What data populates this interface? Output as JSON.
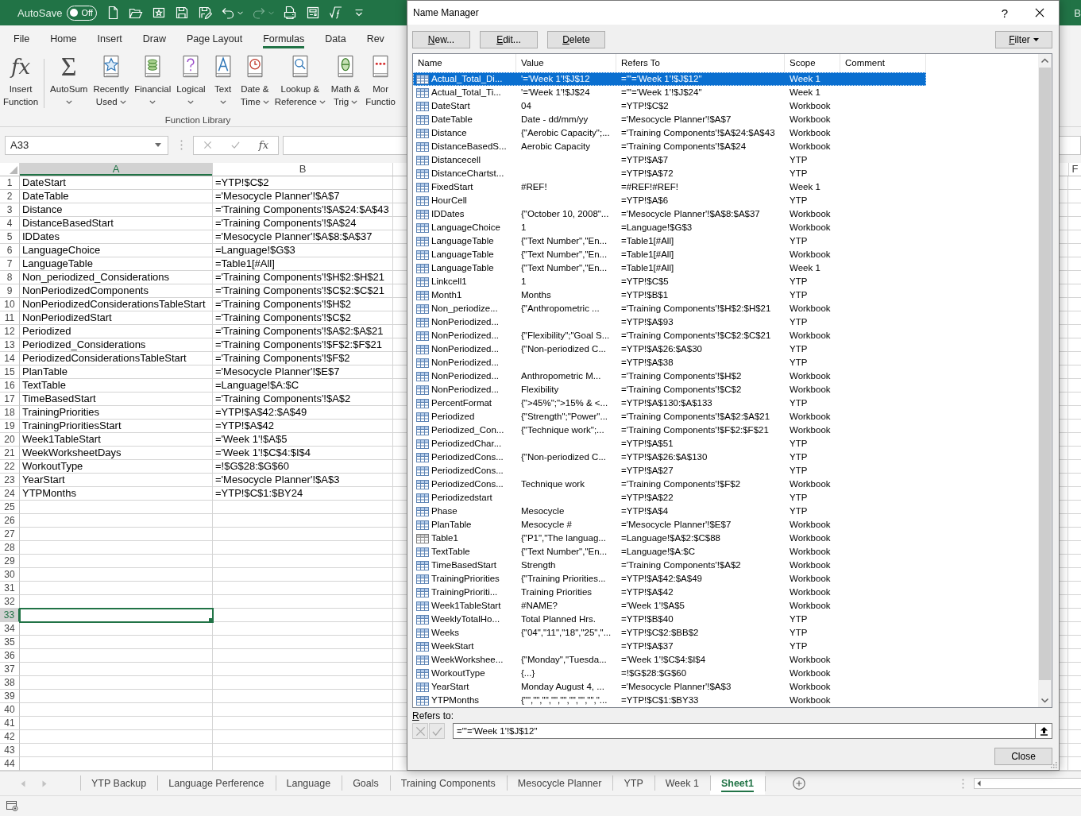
{
  "title_bar": {
    "autosave_label": "AutoSave",
    "autosave": {
      "on": false,
      "label": "Off"
    },
    "quick_access": [
      {
        "kind": "new",
        "disabled": false,
        "dropdown": false
      },
      {
        "kind": "open",
        "disabled": false,
        "dropdown": false
      },
      {
        "kind": "favorites",
        "disabled": false,
        "dropdown": false
      },
      {
        "kind": "save",
        "disabled": false,
        "dropdown": false
      },
      {
        "kind": "save_as",
        "disabled": false,
        "dropdown": false
      },
      {
        "kind": "undo",
        "disabled": false,
        "dropdown": true
      },
      {
        "kind": "redo",
        "disabled": true,
        "dropdown": true
      },
      {
        "kind": "print_preview",
        "disabled": false,
        "dropdown": false
      },
      {
        "kind": "form",
        "disabled": false,
        "dropdown": false
      },
      {
        "kind": "clear_formula",
        "disabled": false,
        "dropdown": false
      },
      {
        "kind": "customize",
        "disabled": false,
        "dropdown": false
      }
    ],
    "title_fragment": "B"
  },
  "ribbon": {
    "tabs": [
      {
        "label": "File",
        "selected": false
      },
      {
        "label": "Home",
        "selected": false
      },
      {
        "label": "Insert",
        "selected": false
      },
      {
        "label": "Draw",
        "selected": false
      },
      {
        "label": "Page Layout",
        "selected": false
      },
      {
        "label": "Formulas",
        "selected": true
      },
      {
        "label": "Data",
        "selected": false
      },
      {
        "label": "Rev",
        "selected": false
      }
    ],
    "group": {
      "label": "Function Library",
      "commands": [
        {
          "kind": "fx",
          "glyph": "fx",
          "lines": [
            "Insert",
            "Function"
          ],
          "dropdown": false,
          "separator_after": true
        },
        {
          "kind": "sum",
          "glyph": "Σ",
          "lines": [
            "AutoSum"
          ],
          "dropdown": true,
          "separator_after": false
        },
        {
          "kind": "recent",
          "lines": [
            "Recently",
            "Used"
          ],
          "dropdown": true,
          "separator_after": false
        },
        {
          "kind": "financial",
          "lines": [
            "Financial"
          ],
          "dropdown": true,
          "separator_after": false
        },
        {
          "kind": "logical",
          "lines": [
            "Logical"
          ],
          "dropdown": true,
          "separator_after": false
        },
        {
          "kind": "text",
          "lines": [
            "Text"
          ],
          "dropdown": true,
          "separator_after": false
        },
        {
          "kind": "datetime",
          "lines": [
            "Date &",
            "Time"
          ],
          "dropdown": true,
          "separator_after": false
        },
        {
          "kind": "lookup",
          "lines": [
            "Lookup &",
            "Reference"
          ],
          "dropdown": true,
          "separator_after": false
        },
        {
          "kind": "math",
          "lines": [
            "Math &",
            "Trig"
          ],
          "dropdown": true,
          "separator_after": false
        },
        {
          "kind": "more",
          "lines": [
            "Mor",
            "Functio"
          ],
          "dropdown": false,
          "separator_after": false
        }
      ]
    }
  },
  "formula_bar": {
    "name_box": "A33",
    "function_glyph": "fx",
    "editing": false
  },
  "sheet": {
    "columns": [
      {
        "label": "A",
        "selected": true
      },
      {
        "label": "B",
        "selected": false
      }
    ],
    "edge_column": {
      "label": "F",
      "selected": false
    },
    "rows": [
      {
        "number": "1",
        "cells": [
          "DateStart",
          "=YTP!$C$2"
        ],
        "selected": false
      },
      {
        "number": "2",
        "cells": [
          "DateTable",
          "='Mesocycle Planner'!$A$7"
        ],
        "selected": false
      },
      {
        "number": "3",
        "cells": [
          "Distance",
          "='Training Components'!$A$24:$A$43"
        ],
        "selected": false
      },
      {
        "number": "4",
        "cells": [
          "DistanceBasedStart",
          "='Training Components'!$A$24"
        ],
        "selected": false
      },
      {
        "number": "5",
        "cells": [
          "IDDates",
          "='Mesocycle Planner'!$A$8:$A$37"
        ],
        "selected": false
      },
      {
        "number": "6",
        "cells": [
          "LanguageChoice",
          "=Language!$G$3"
        ],
        "selected": false
      },
      {
        "number": "7",
        "cells": [
          "LanguageTable",
          "=Table1[#All]"
        ],
        "selected": false
      },
      {
        "number": "8",
        "cells": [
          "Non_periodized_Considerations",
          "='Training Components'!$H$2:$H$21"
        ],
        "selected": false
      },
      {
        "number": "9",
        "cells": [
          "NonPeriodizedComponents",
          "='Training Components'!$C$2:$C$21"
        ],
        "selected": false
      },
      {
        "number": "10",
        "cells": [
          "NonPeriodizedConsiderationsTableStart",
          "='Training Components'!$H$2"
        ],
        "selected": false
      },
      {
        "number": "11",
        "cells": [
          "NonPeriodizedStart",
          "='Training Components'!$C$2"
        ],
        "selected": false
      },
      {
        "number": "12",
        "cells": [
          "Periodized",
          "='Training Components'!$A$2:$A$21"
        ],
        "selected": false
      },
      {
        "number": "13",
        "cells": [
          "Periodized_Considerations",
          "='Training Components'!$F$2:$F$21"
        ],
        "selected": false
      },
      {
        "number": "14",
        "cells": [
          "PeriodizedConsiderationsTableStart",
          "='Training Components'!$F$2"
        ],
        "selected": false
      },
      {
        "number": "15",
        "cells": [
          "PlanTable",
          "='Mesocycle Planner'!$E$7"
        ],
        "selected": false
      },
      {
        "number": "16",
        "cells": [
          "TextTable",
          "=Language!$A:$C"
        ],
        "selected": false
      },
      {
        "number": "17",
        "cells": [
          "TimeBasedStart",
          "='Training Components'!$A$2"
        ],
        "selected": false
      },
      {
        "number": "18",
        "cells": [
          "TrainingPriorities",
          "=YTP!$A$42:$A$49"
        ],
        "selected": false
      },
      {
        "number": "19",
        "cells": [
          "TrainingPrioritiesStart",
          "=YTP!$A$42"
        ],
        "selected": false
      },
      {
        "number": "20",
        "cells": [
          "Week1TableStart",
          "='Week 1'!$A$5"
        ],
        "selected": false
      },
      {
        "number": "21",
        "cells": [
          "WeekWorksheetDays",
          "='Week 1'!$C$4:$I$4"
        ],
        "selected": false
      },
      {
        "number": "22",
        "cells": [
          "WorkoutType",
          "=!$G$28:$G$60"
        ],
        "selected": false
      },
      {
        "number": "23",
        "cells": [
          "YearStart",
          "='Mesocycle Planner'!$A$3"
        ],
        "selected": false
      },
      {
        "number": "24",
        "cells": [
          "YTPMonths",
          "=YTP!$C$1:$BY24"
        ],
        "selected": false
      },
      {
        "number": "25",
        "selected": false
      },
      {
        "number": "26",
        "selected": false
      },
      {
        "number": "27",
        "selected": false
      },
      {
        "number": "28",
        "selected": false
      },
      {
        "number": "29",
        "selected": false
      },
      {
        "number": "30",
        "selected": false
      },
      {
        "number": "31",
        "selected": false
      },
      {
        "number": "32",
        "selected": false
      },
      {
        "number": "33",
        "selected": true
      },
      {
        "number": "34",
        "selected": false
      },
      {
        "number": "35",
        "selected": false
      },
      {
        "number": "36",
        "selected": false
      },
      {
        "number": "37",
        "selected": false
      },
      {
        "number": "38",
        "selected": false
      },
      {
        "number": "39",
        "selected": false
      },
      {
        "number": "40",
        "selected": false
      },
      {
        "number": "41",
        "selected": false
      },
      {
        "number": "42",
        "selected": false
      },
      {
        "number": "43",
        "selected": false
      },
      {
        "number": "44",
        "selected": false
      }
    ]
  },
  "sheet_tabs": {
    "nav_disabled": true,
    "tabs": [
      {
        "label": "YTP Backup",
        "selected": false
      },
      {
        "label": "Language Perference",
        "selected": false
      },
      {
        "label": "Language",
        "selected": false
      },
      {
        "label": "Goals",
        "selected": false
      },
      {
        "label": "Training Components",
        "selected": false
      },
      {
        "label": "Mesocycle Planner",
        "selected": false
      },
      {
        "label": "YTP",
        "selected": false
      },
      {
        "label": "Week 1",
        "selected": false
      },
      {
        "label": "Sheet1",
        "selected": true
      }
    ]
  },
  "name_manager": {
    "title": "Name Manager",
    "help": "?",
    "buttons": [
      {
        "label": "New...",
        "mnemonic": true
      },
      {
        "label": "Edit...",
        "mnemonic": true
      },
      {
        "label": "Delete",
        "mnemonic": true
      }
    ],
    "filter": {
      "label": "Filter",
      "mnemonic": true
    },
    "columns": [
      "Name",
      "Value",
      "Refers To",
      "Scope",
      "Comment"
    ],
    "rows": [
      {
        "kind": "name",
        "name": "Actual_Total_Di...",
        "value": "'='Week 1'!$J$12",
        "refers_to": "=\"'='Week 1'!$J$12\"",
        "scope": "Week 1",
        "selected": true
      },
      {
        "kind": "name",
        "name": "Actual_Total_Ti...",
        "value": "'='Week 1'!$J$24",
        "refers_to": "=\"'='Week 1'!$J$24\"",
        "scope": "Week 1",
        "selected": false
      },
      {
        "kind": "name",
        "name": "DateStart",
        "value": "04",
        "refers_to": "=YTP!$C$2",
        "scope": "Workbook",
        "selected": false
      },
      {
        "kind": "name",
        "name": "DateTable",
        "value": "Date - dd/mm/yy",
        "refers_to": "='Mesocycle Planner'!$A$7",
        "scope": "Workbook",
        "selected": false
      },
      {
        "kind": "name",
        "name": "Distance",
        "value": "{\"Aerobic Capacity\";...",
        "refers_to": "='Training Components'!$A$24:$A$43",
        "scope": "Workbook",
        "selected": false
      },
      {
        "kind": "name",
        "name": "DistanceBasedS...",
        "value": "Aerobic Capacity",
        "refers_to": "='Training Components'!$A$24",
        "scope": "Workbook",
        "selected": false
      },
      {
        "kind": "name",
        "name": "Distancecell",
        "refers_to": "=YTP!$A$7",
        "scope": "YTP",
        "selected": false
      },
      {
        "kind": "name",
        "name": "DistanceChartst...",
        "refers_to": "=YTP!$A$72",
        "scope": "YTP",
        "selected": false
      },
      {
        "kind": "name",
        "name": "FixedStart",
        "value": "#REF!",
        "refers_to": "=#REF!#REF!",
        "scope": "Week 1",
        "selected": false
      },
      {
        "kind": "name",
        "name": "HourCell",
        "refers_to": "=YTP!$A$6",
        "scope": "YTP",
        "selected": false
      },
      {
        "kind": "name",
        "name": "IDDates",
        "value": "{\"October 10, 2008\"...",
        "refers_to": "='Mesocycle Planner'!$A$8:$A$37",
        "scope": "Workbook",
        "selected": false
      },
      {
        "kind": "name",
        "name": "LanguageChoice",
        "value": "1",
        "refers_to": "=Language!$G$3",
        "scope": "Workbook",
        "selected": false
      },
      {
        "kind": "name",
        "name": "LanguageTable",
        "value": "{\"Text Number\",\"En...",
        "refers_to": "=Table1[#All]",
        "scope": "YTP",
        "selected": false
      },
      {
        "kind": "name",
        "name": "LanguageTable",
        "value": "{\"Text Number\",\"En...",
        "refers_to": "=Table1[#All]",
        "scope": "Workbook",
        "selected": false
      },
      {
        "kind": "name",
        "name": "LanguageTable",
        "value": "{\"Text Number\",\"En...",
        "refers_to": "=Table1[#All]",
        "scope": "Week 1",
        "selected": false
      },
      {
        "kind": "name",
        "name": "Linkcell1",
        "value": "1",
        "refers_to": "=YTP!$C$5",
        "scope": "YTP",
        "selected": false
      },
      {
        "kind": "name",
        "name": "Month1",
        "value": "Months",
        "refers_to": "=YTP!$B$1",
        "scope": "YTP",
        "selected": false
      },
      {
        "kind": "name",
        "name": "Non_periodize...",
        "value": "{\"Anthropometric ...",
        "refers_to": "='Training Components'!$H$2:$H$21",
        "scope": "Workbook",
        "selected": false
      },
      {
        "kind": "name",
        "name": "NonPeriodized...",
        "refers_to": "=YTP!$A$93",
        "scope": "YTP",
        "selected": false
      },
      {
        "kind": "name",
        "name": "NonPeriodized...",
        "value": "{\"Flexibility\";\"Goal S...",
        "refers_to": "='Training Components'!$C$2:$C$21",
        "scope": "Workbook",
        "selected": false
      },
      {
        "kind": "name",
        "name": "NonPeriodized...",
        "value": "{\"Non-periodized C...",
        "refers_to": "=YTP!$A$26:$A$30",
        "scope": "YTP",
        "selected": false
      },
      {
        "kind": "name",
        "name": "NonPeriodized...",
        "refers_to": "=YTP!$A$38",
        "scope": "YTP",
        "selected": false
      },
      {
        "kind": "name",
        "name": "NonPeriodized...",
        "value": "Anthropometric M...",
        "refers_to": "='Training Components'!$H$2",
        "scope": "Workbook",
        "selected": false
      },
      {
        "kind": "name",
        "name": "NonPeriodized...",
        "value": "Flexibility",
        "refers_to": "='Training Components'!$C$2",
        "scope": "Workbook",
        "selected": false
      },
      {
        "kind": "name",
        "name": "PercentFormat",
        "value": "{\">45%\";\">15% & <...",
        "refers_to": "=YTP!$A$130:$A$133",
        "scope": "YTP",
        "selected": false
      },
      {
        "kind": "name",
        "name": "Periodized",
        "value": "{\"Strength\";\"Power\"...",
        "refers_to": "='Training Components'!$A$2:$A$21",
        "scope": "Workbook",
        "selected": false
      },
      {
        "kind": "name",
        "name": "Periodized_Con...",
        "value": "{\"Technique work\";...",
        "refers_to": "='Training Components'!$F$2:$F$21",
        "scope": "Workbook",
        "selected": false
      },
      {
        "kind": "name",
        "name": "PeriodizedChar...",
        "refers_to": "=YTP!$A$51",
        "scope": "YTP",
        "selected": false
      },
      {
        "kind": "name",
        "name": "PeriodizedCons...",
        "value": "{\"Non-periodized C...",
        "refers_to": "=YTP!$A$26:$A$130",
        "scope": "YTP",
        "selected": false
      },
      {
        "kind": "name",
        "name": "PeriodizedCons...",
        "refers_to": "=YTP!$A$27",
        "scope": "YTP",
        "selected": false
      },
      {
        "kind": "name",
        "name": "PeriodizedCons...",
        "value": "Technique work",
        "refers_to": "='Training Components'!$F$2",
        "scope": "Workbook",
        "selected": false
      },
      {
        "kind": "name",
        "name": "Periodizedstart",
        "refers_to": "=YTP!$A$22",
        "scope": "YTP",
        "selected": false
      },
      {
        "kind": "name",
        "name": "Phase",
        "value": "Mesocycle",
        "refers_to": "=YTP!$A$4",
        "scope": "YTP",
        "selected": false
      },
      {
        "kind": "name",
        "name": "PlanTable",
        "value": "Mesocycle #",
        "refers_to": "='Mesocycle Planner'!$E$7",
        "scope": "Workbook",
        "selected": false
      },
      {
        "kind": "table",
        "name": "Table1",
        "value": "{\"P1\",\"The languag...",
        "refers_to": "=Language!$A$2:$C$88",
        "scope": "Workbook",
        "selected": false
      },
      {
        "kind": "name",
        "name": "TextTable",
        "value": "{\"Text Number\",\"En...",
        "refers_to": "=Language!$A:$C",
        "scope": "Workbook",
        "selected": false
      },
      {
        "kind": "name",
        "name": "TimeBasedStart",
        "value": "Strength",
        "refers_to": "='Training Components'!$A$2",
        "scope": "Workbook",
        "selected": false
      },
      {
        "kind": "name",
        "name": "TrainingPriorities",
        "value": "{\"Training Priorities...",
        "refers_to": "=YTP!$A$42:$A$49",
        "scope": "Workbook",
        "selected": false
      },
      {
        "kind": "name",
        "name": "TrainingPrioriti...",
        "value": "Training Priorities",
        "refers_to": "=YTP!$A$42",
        "scope": "Workbook",
        "selected": false
      },
      {
        "kind": "name",
        "name": "Week1TableStart",
        "value": "#NAME?",
        "refers_to": "='Week 1'!$A$5",
        "scope": "Workbook",
        "selected": false
      },
      {
        "kind": "name",
        "name": "WeeklyTotalHo...",
        "value": "Total Planned Hrs.",
        "refers_to": "=YTP!$B$40",
        "scope": "YTP",
        "selected": false
      },
      {
        "kind": "name",
        "name": "Weeks",
        "value": "{\"04\",\"11\",\"18\",\"25\",\"...",
        "refers_to": "=YTP!$C$2:$BB$2",
        "scope": "YTP",
        "selected": false
      },
      {
        "kind": "name",
        "name": "WeekStart",
        "refers_to": "=YTP!$A$37",
        "scope": "YTP",
        "selected": false
      },
      {
        "kind": "name",
        "name": "WeekWorkshee...",
        "value": "{\"Monday\",\"Tuesda...",
        "refers_to": "='Week 1'!$C$4:$I$4",
        "scope": "Workbook",
        "selected": false
      },
      {
        "kind": "name",
        "name": "WorkoutType",
        "value": "{...}",
        "refers_to": "=!$G$28:$G$60",
        "scope": "Workbook",
        "selected": false
      },
      {
        "kind": "name",
        "name": "YearStart",
        "value": "Monday August 4, ...",
        "refers_to": "='Mesocycle Planner'!$A$3",
        "scope": "Workbook",
        "selected": false
      },
      {
        "kind": "name",
        "name": "YTPMonths",
        "value": "{\"\",\"\",\"\",\"\",\"\",\"\",\"\",\"\",\"...",
        "refers_to": "=YTP!$C$1:$BY33",
        "scope": "Workbook",
        "selected": false
      }
    ],
    "refers_to": {
      "label": "Refers to:",
      "mnemonic": true,
      "value": "=\"'='Week 1'!$J$12\"",
      "editing": false
    },
    "close_label": "Close"
  }
}
